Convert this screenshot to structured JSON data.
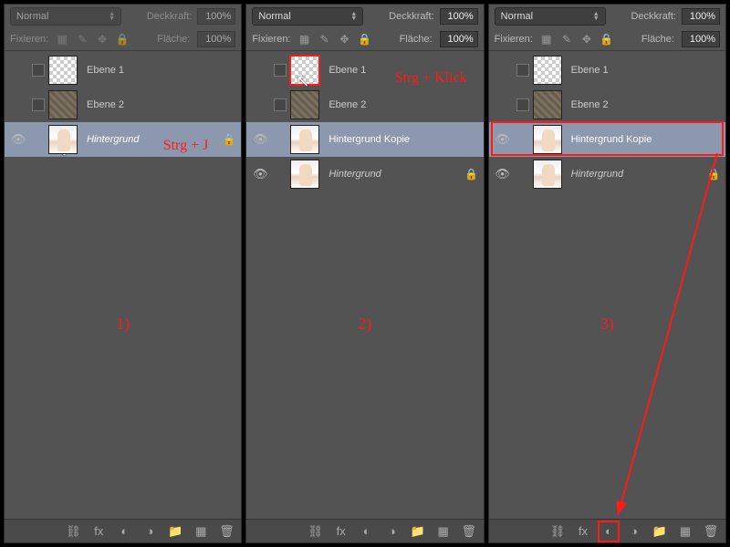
{
  "common": {
    "blend_mode": "Normal",
    "opacity_label": "Deckkraft:",
    "opacity_value": "100%",
    "lock_label": "Fixieren:",
    "fill_label": "Fläche:",
    "fill_value": "100%"
  },
  "panels": [
    {
      "id": "p1",
      "controls_dimmed": true,
      "step": "1)",
      "hint": "Strg + J",
      "layers": [
        {
          "eye": false,
          "chk": true,
          "thumb": "transp",
          "name": "Ebene 1",
          "sel": false,
          "ital": false,
          "lock": false,
          "hl": false
        },
        {
          "eye": false,
          "chk": true,
          "thumb": "texture",
          "name": "Ebene 2",
          "sel": false,
          "ital": false,
          "lock": false,
          "hl": false
        },
        {
          "eye": true,
          "chk": false,
          "thumb": "photo",
          "name": "Hintergrund",
          "sel": true,
          "ital": true,
          "lock": true,
          "hl": false,
          "cursor": true
        }
      ]
    },
    {
      "id": "p2",
      "controls_dimmed": false,
      "step": "2)",
      "hint": "Strg + Klick",
      "layers": [
        {
          "eye": false,
          "chk": true,
          "thumb": "transp",
          "name": "Ebene 1",
          "sel": false,
          "ital": false,
          "lock": false,
          "hl": true,
          "cursor": true
        },
        {
          "eye": false,
          "chk": true,
          "thumb": "texture",
          "name": "Ebene 2",
          "sel": false,
          "ital": false,
          "lock": false,
          "hl": false
        },
        {
          "eye": true,
          "chk": false,
          "thumb": "photo",
          "name": "Hintergrund Kopie",
          "sel": true,
          "ital": false,
          "lock": false,
          "hl": false
        },
        {
          "eye": true,
          "chk": false,
          "thumb": "photo",
          "name": "Hintergrund",
          "sel": false,
          "ital": true,
          "lock": true,
          "hl": false
        }
      ]
    },
    {
      "id": "p3",
      "controls_dimmed": false,
      "step": "3)",
      "hint": "",
      "layers": [
        {
          "eye": false,
          "chk": true,
          "thumb": "transp",
          "name": "Ebene 1",
          "sel": false,
          "ital": false,
          "lock": false,
          "hl": false
        },
        {
          "eye": false,
          "chk": true,
          "thumb": "texture",
          "name": "Ebene 2",
          "sel": false,
          "ital": false,
          "lock": false,
          "hl": false
        },
        {
          "eye": true,
          "chk": false,
          "thumb": "photo",
          "name": "Hintergrund Kopie",
          "sel": true,
          "ital": false,
          "lock": false,
          "hl": false,
          "boxrow": true
        },
        {
          "eye": true,
          "chk": false,
          "thumb": "photo",
          "name": "Hintergrund",
          "sel": false,
          "ital": true,
          "lock": true,
          "hl": false
        }
      ]
    }
  ],
  "bottom_icons": [
    "link-icon",
    "fx-icon",
    "mask-icon",
    "adjust-icon",
    "group-icon",
    "new-icon",
    "trash-icon"
  ],
  "bottom_glyph": {
    "link-icon": "⛓",
    "fx-icon": "fx",
    "mask-icon": "◐",
    "adjust-icon": "◑",
    "group-icon": "📁",
    "new-icon": "▦",
    "trash-icon": "🗑"
  }
}
